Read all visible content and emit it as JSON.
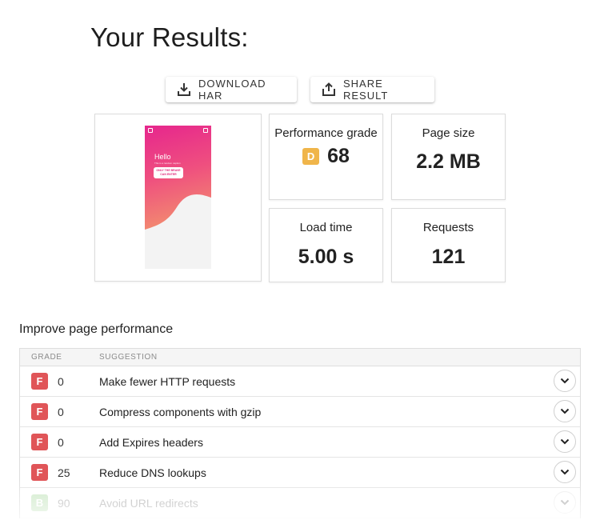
{
  "page": {
    "title": "Your Results:"
  },
  "actions": {
    "download_label": "DOWNLOAD HAR",
    "share_label": "SHARE RESULT"
  },
  "screenshot_preview": {
    "heading": "Hello",
    "subtitle": "This is a random caption",
    "button_label": "ONLY THE BRAVE CAN ENTER"
  },
  "metrics": {
    "performance": {
      "label": "Performance grade",
      "grade": "D",
      "value": "68",
      "grade_color": "#f0b54a"
    },
    "page_size": {
      "label": "Page size",
      "value": "2.2 MB"
    },
    "load_time": {
      "label": "Load time",
      "value": "5.00 s"
    },
    "requests": {
      "label": "Requests",
      "value": "121"
    }
  },
  "suggestions": {
    "title": "Improve page performance",
    "columns": {
      "grade": "GRADE",
      "suggestion": "SUGGESTION"
    },
    "rows": [
      {
        "grade": "F",
        "score": "0",
        "text": "Make fewer HTTP requests",
        "color": "#e05558"
      },
      {
        "grade": "F",
        "score": "0",
        "text": "Compress components with gzip",
        "color": "#e05558"
      },
      {
        "grade": "F",
        "score": "0",
        "text": "Add Expires headers",
        "color": "#e05558"
      },
      {
        "grade": "F",
        "score": "25",
        "text": "Reduce DNS lookups",
        "color": "#e05558"
      },
      {
        "grade": "B",
        "score": "90",
        "text": "Avoid URL redirects",
        "color": "#7cc46c"
      }
    ]
  }
}
